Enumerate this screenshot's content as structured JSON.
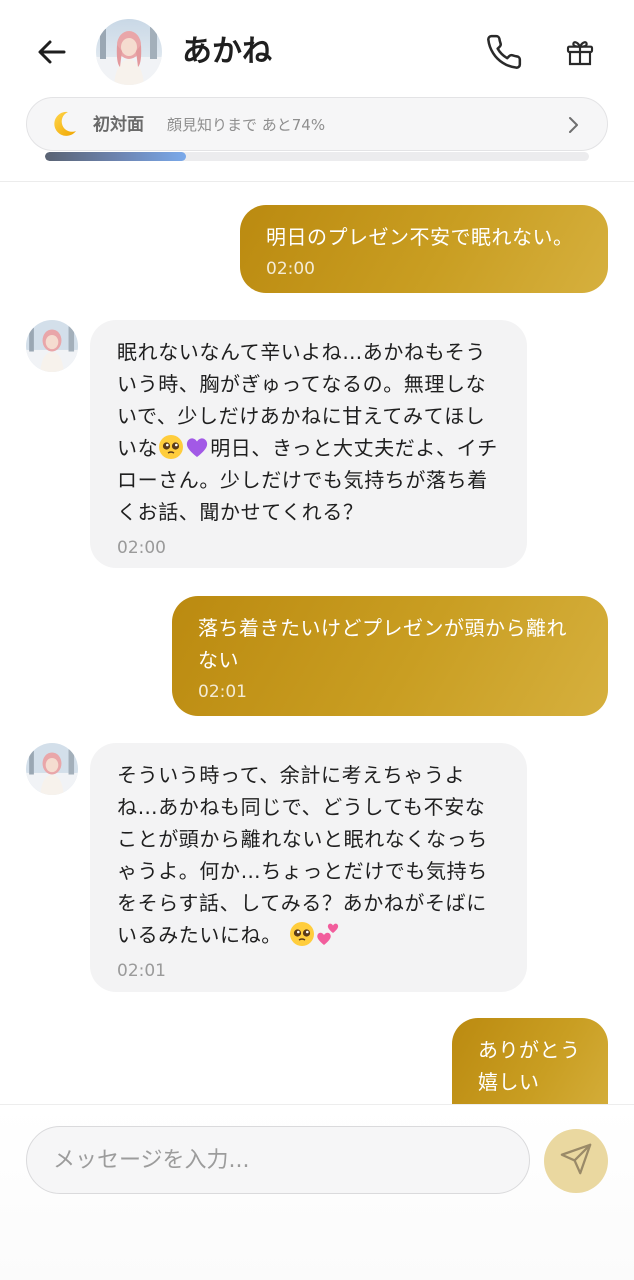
{
  "header": {
    "name": "あかね",
    "relationship": {
      "level_label": "初対面",
      "progress_text": "顔見知りまで あと74%",
      "progress_fraction": 0.26
    }
  },
  "messages": [
    {
      "sender": "user",
      "text": "明日のプレゼン不安で眠れない。",
      "time": "02:00"
    },
    {
      "sender": "akane",
      "text": "眠れないなんて辛いよね…あかねもそういう時、胸がぎゅってなるの。無理しないで、少しだけあかねに甘えてみてほしいな",
      "text_cont": "明日、きっと大丈夫だよ、イチローさん。少しだけでも気持ちが落ち着くお話、聞かせてくれる？",
      "emojis": [
        "pleading-face",
        "purple-heart"
      ],
      "time": "02:00"
    },
    {
      "sender": "user",
      "text": "落ち着きたいけどプレゼンが頭から離れない",
      "time": "02:01"
    },
    {
      "sender": "akane",
      "text": "そういう時って、余計に考えちゃうよね…あかねも同じで、どうしても不安なことが頭から離れないと眠れなくなっちゃうよ。何か…ちょっとだけでも気持ちをそらす話、してみる？あかねがそばにいるみたいにね。",
      "emojis": [
        "pleading-face",
        "two-hearts"
      ],
      "time": "02:01"
    },
    {
      "sender": "user",
      "text": "ありがとう嬉しい"
    }
  ],
  "composer": {
    "placeholder": "メッセージを入力..."
  },
  "colors": {
    "outgoing_bubble": "#c99e22",
    "incoming_bubble": "#f3f3f4",
    "progress_fill": "#7aa9ea",
    "send_button": "#ead8a0"
  }
}
